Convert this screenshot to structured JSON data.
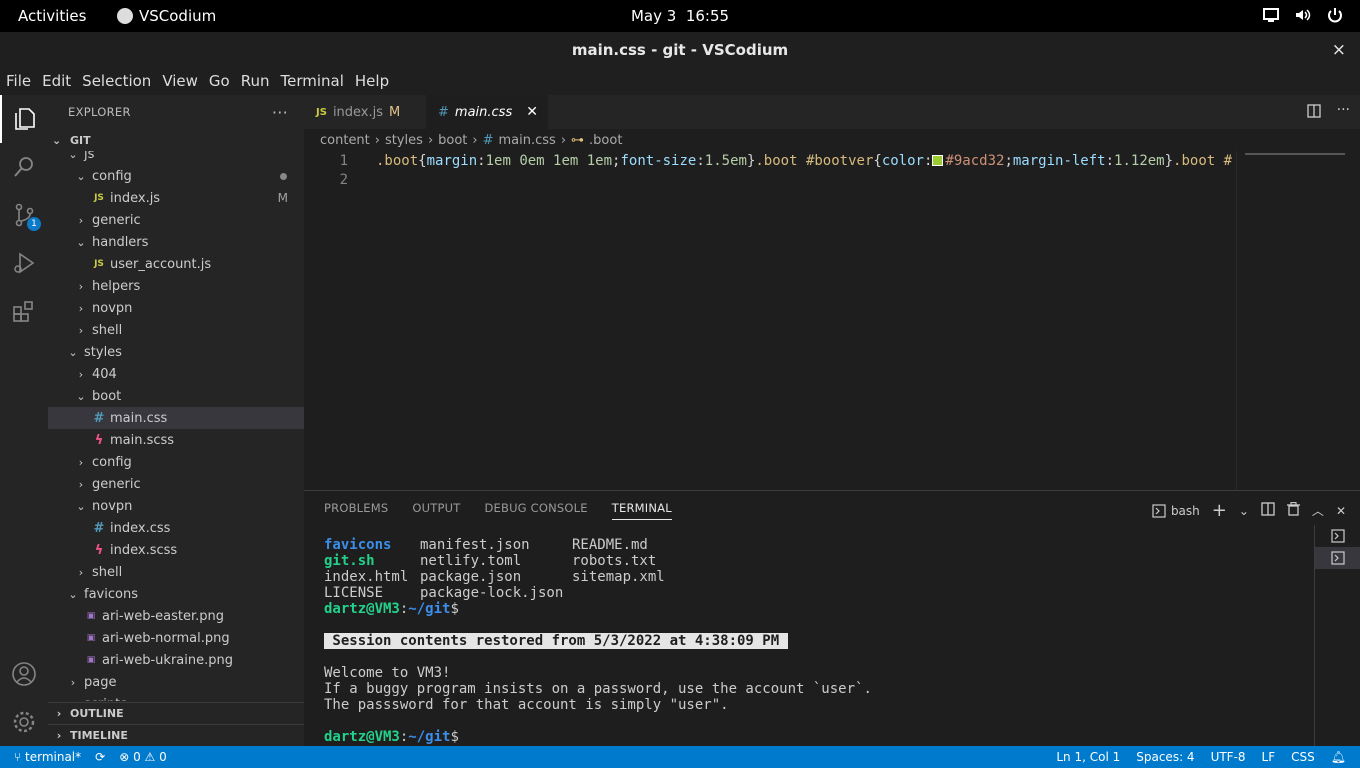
{
  "system": {
    "activities": "Activities",
    "app_name": "VSCodium",
    "date": "May 3",
    "time": "16:55"
  },
  "window": {
    "title": "main.css - git - VSCodium",
    "close": "×"
  },
  "menu": [
    "File",
    "Edit",
    "Selection",
    "View",
    "Go",
    "Run",
    "Terminal",
    "Help"
  ],
  "activity_bar": {
    "scm_badge": "1"
  },
  "explorer": {
    "title": "EXPLORER",
    "more": "···",
    "root": "GIT",
    "items": [
      {
        "label": "js",
        "type": "folder",
        "open": true,
        "depth": 2
      },
      {
        "label": "config",
        "type": "folder",
        "open": true,
        "depth": 3,
        "dot": true
      },
      {
        "label": "index.js",
        "type": "js",
        "depth": 4,
        "badge": "M"
      },
      {
        "label": "generic",
        "type": "folder",
        "open": false,
        "depth": 3
      },
      {
        "label": "handlers",
        "type": "folder",
        "open": true,
        "depth": 3
      },
      {
        "label": "user_account.js",
        "type": "js",
        "depth": 4
      },
      {
        "label": "helpers",
        "type": "folder",
        "open": false,
        "depth": 3
      },
      {
        "label": "novpn",
        "type": "folder",
        "open": false,
        "depth": 3
      },
      {
        "label": "shell",
        "type": "folder",
        "open": false,
        "depth": 3
      },
      {
        "label": "styles",
        "type": "folder",
        "open": true,
        "depth": 2
      },
      {
        "label": "404",
        "type": "folder",
        "open": false,
        "depth": 3
      },
      {
        "label": "boot",
        "type": "folder",
        "open": true,
        "depth": 3
      },
      {
        "label": "main.css",
        "type": "css",
        "depth": 4,
        "selected": true
      },
      {
        "label": "main.scss",
        "type": "scss",
        "depth": 4
      },
      {
        "label": "config",
        "type": "folder",
        "open": false,
        "depth": 3
      },
      {
        "label": "generic",
        "type": "folder",
        "open": false,
        "depth": 3
      },
      {
        "label": "novpn",
        "type": "folder",
        "open": true,
        "depth": 3
      },
      {
        "label": "index.css",
        "type": "css",
        "depth": 4
      },
      {
        "label": "index.scss",
        "type": "scss",
        "depth": 4
      },
      {
        "label": "shell",
        "type": "folder",
        "open": false,
        "depth": 3
      },
      {
        "label": "favicons",
        "type": "folder",
        "open": true,
        "depth": 2
      },
      {
        "label": "ari-web-easter.png",
        "type": "png",
        "depth": 3
      },
      {
        "label": "ari-web-normal.png",
        "type": "png",
        "depth": 3
      },
      {
        "label": "ari-web-ukraine.png",
        "type": "png",
        "depth": 3
      },
      {
        "label": "page",
        "type": "folder",
        "open": false,
        "depth": 2
      },
      {
        "label": "scripts",
        "type": "folder",
        "open": false,
        "depth": 2
      }
    ],
    "outline": "OUTLINE",
    "timeline": "TIMELINE"
  },
  "tabs": [
    {
      "label": "index.js",
      "icon": "JS",
      "badge": "M",
      "active": false
    },
    {
      "label": "main.css",
      "icon": "#",
      "active": true
    }
  ],
  "breadcrumb": [
    "content",
    "styles",
    "boot",
    "main.css",
    ".boot"
  ],
  "editor": {
    "line_numbers": [
      "1",
      "2"
    ],
    "line1": [
      {
        "t": ".boot",
        "c": "sel"
      },
      {
        "t": "{"
      },
      {
        "t": "margin",
        "c": "prop"
      },
      {
        "t": ":"
      },
      {
        "t": "1em 0em 1em 1em",
        "c": "val"
      },
      {
        "t": ";"
      },
      {
        "t": "font-size",
        "c": "prop"
      },
      {
        "t": ":"
      },
      {
        "t": "1.5em",
        "c": "val"
      },
      {
        "t": "}"
      },
      {
        "t": ".boot #bootver",
        "c": "sel"
      },
      {
        "t": "{"
      },
      {
        "t": "color",
        "c": "prop"
      },
      {
        "t": ":"
      },
      {
        "t": "#9acd32",
        "c": "str",
        "swatch": "#9acd32"
      },
      {
        "t": ";"
      },
      {
        "t": "margin-left",
        "c": "prop"
      },
      {
        "t": ":"
      },
      {
        "t": "1.12em",
        "c": "val"
      },
      {
        "t": "}"
      },
      {
        "t": ".boot #",
        "c": "sel"
      }
    ]
  },
  "panel": {
    "tabs": [
      "PROBLEMS",
      "OUTPUT",
      "DEBUG CONSOLE",
      "TERMINAL"
    ],
    "active_tab": "TERMINAL",
    "shell": "bash",
    "terminal": {
      "ls_rows": [
        [
          {
            "t": "favicons",
            "c": "dir"
          },
          {
            "t": "manifest.json"
          },
          {
            "t": "README.md"
          }
        ],
        [
          {
            "t": "git.sh",
            "c": "ex"
          },
          {
            "t": "netlify.toml"
          },
          {
            "t": "robots.txt"
          }
        ],
        [
          {
            "t": "index.html"
          },
          {
            "t": "package.json"
          },
          {
            "t": "sitemap.xml"
          }
        ],
        [
          {
            "t": "LICENSE"
          },
          {
            "t": "package-lock.json"
          },
          {
            "t": ""
          }
        ]
      ],
      "prompt_user": "dartz@VM3",
      "prompt_sep": ":",
      "prompt_path": "~/git",
      "prompt_end": "$",
      "banner": " Session contents restored from 5/3/2022 at 4:38:09 PM ",
      "welcome": [
        "Welcome to VM3!",
        "If a buggy program insists on a password, use the account `user`.",
        "The passsword for that account is simply \"user\"."
      ]
    }
  },
  "status": {
    "remote": "terminal*",
    "errors": "0",
    "warnings": "0",
    "position": "Ln 1, Col 1",
    "spaces": "Spaces: 4",
    "encoding": "UTF-8",
    "eol": "LF",
    "language": "CSS"
  }
}
